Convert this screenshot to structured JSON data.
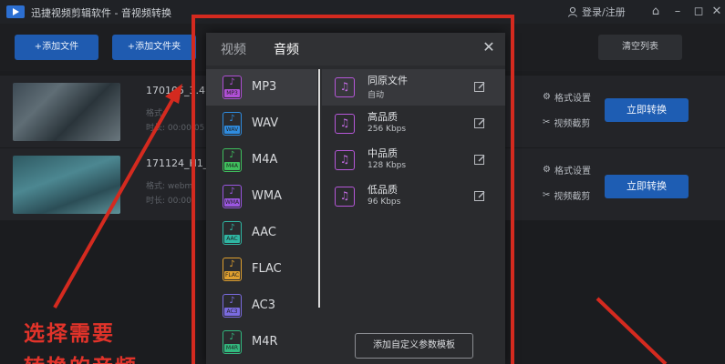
{
  "titlebar": {
    "app_title": "迅捷视频剪辑软件 - 音视频转换",
    "login": "登录/注册"
  },
  "toolbar": {
    "add_file": "+添加文件",
    "add_folder": "+添加文件夹",
    "clear_list": "清空列表"
  },
  "files": [
    {
      "name": "170105_3.4K_",
      "meta1": "格式: ",
      "meta2": "时长: 00:00:05",
      "settings": "格式设置",
      "clip": "视频截剪",
      "convert": "立即转换"
    },
    {
      "name": "171124_H1_0",
      "meta1": "格式: webm",
      "meta2": "时长: 00:00:",
      "settings": "格式设置",
      "clip": "视频截剪",
      "convert": "立即转换"
    }
  ],
  "dialog": {
    "tab_video": "视频",
    "tab_audio": "音频",
    "formats": [
      {
        "label": "MP3",
        "tag": "MP3",
        "color": "#b04fd6"
      },
      {
        "label": "WAV",
        "tag": "WAV",
        "color": "#2f8cdf"
      },
      {
        "label": "M4A",
        "tag": "M4A",
        "color": "#3fbf5d"
      },
      {
        "label": "WMA",
        "tag": "WMA",
        "color": "#9a56e0"
      },
      {
        "label": "AAC",
        "tag": "AAC",
        "color": "#2fb6a3"
      },
      {
        "label": "FLAC",
        "tag": "FLAC",
        "color": "#e0a02f"
      },
      {
        "label": "AC3",
        "tag": "AC3",
        "color": "#7a6be0"
      },
      {
        "label": "M4R",
        "tag": "M4R",
        "color": "#32b87e"
      }
    ],
    "qualities": [
      {
        "name": "同原文件",
        "sub": "自动"
      },
      {
        "name": "高品质",
        "sub": "256 Kbps"
      },
      {
        "name": "中品质",
        "sub": "128 Kbps"
      },
      {
        "name": "低品质",
        "sub": "96 Kbps"
      }
    ],
    "custom_button": "添加自定义参数模板"
  },
  "annotation": {
    "line1": "选择需要",
    "line2": "转换的音频"
  }
}
